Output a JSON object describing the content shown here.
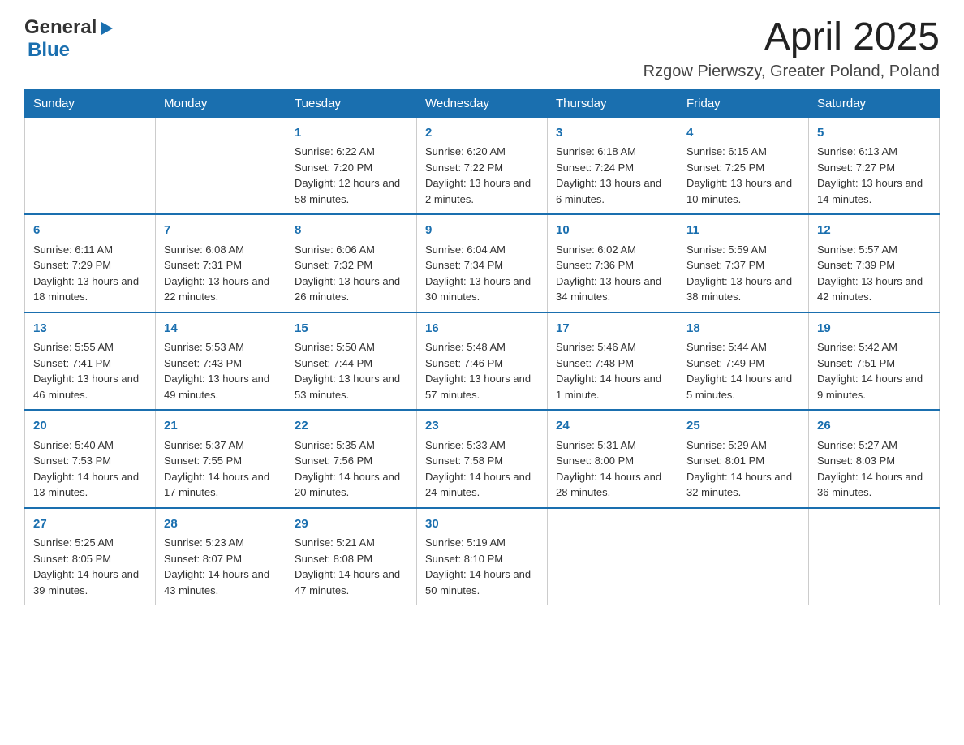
{
  "header": {
    "logo": {
      "general": "General",
      "triangle": "▶",
      "blue": "Blue"
    },
    "month_title": "April 2025",
    "location": "Rzgow Pierwszy, Greater Poland, Poland"
  },
  "weekdays": [
    "Sunday",
    "Monday",
    "Tuesday",
    "Wednesday",
    "Thursday",
    "Friday",
    "Saturday"
  ],
  "weeks": [
    [
      {
        "day": "",
        "sunrise": "",
        "sunset": "",
        "daylight": ""
      },
      {
        "day": "",
        "sunrise": "",
        "sunset": "",
        "daylight": ""
      },
      {
        "day": "1",
        "sunrise": "Sunrise: 6:22 AM",
        "sunset": "Sunset: 7:20 PM",
        "daylight": "Daylight: 12 hours and 58 minutes."
      },
      {
        "day": "2",
        "sunrise": "Sunrise: 6:20 AM",
        "sunset": "Sunset: 7:22 PM",
        "daylight": "Daylight: 13 hours and 2 minutes."
      },
      {
        "day": "3",
        "sunrise": "Sunrise: 6:18 AM",
        "sunset": "Sunset: 7:24 PM",
        "daylight": "Daylight: 13 hours and 6 minutes."
      },
      {
        "day": "4",
        "sunrise": "Sunrise: 6:15 AM",
        "sunset": "Sunset: 7:25 PM",
        "daylight": "Daylight: 13 hours and 10 minutes."
      },
      {
        "day": "5",
        "sunrise": "Sunrise: 6:13 AM",
        "sunset": "Sunset: 7:27 PM",
        "daylight": "Daylight: 13 hours and 14 minutes."
      }
    ],
    [
      {
        "day": "6",
        "sunrise": "Sunrise: 6:11 AM",
        "sunset": "Sunset: 7:29 PM",
        "daylight": "Daylight: 13 hours and 18 minutes."
      },
      {
        "day": "7",
        "sunrise": "Sunrise: 6:08 AM",
        "sunset": "Sunset: 7:31 PM",
        "daylight": "Daylight: 13 hours and 22 minutes."
      },
      {
        "day": "8",
        "sunrise": "Sunrise: 6:06 AM",
        "sunset": "Sunset: 7:32 PM",
        "daylight": "Daylight: 13 hours and 26 minutes."
      },
      {
        "day": "9",
        "sunrise": "Sunrise: 6:04 AM",
        "sunset": "Sunset: 7:34 PM",
        "daylight": "Daylight: 13 hours and 30 minutes."
      },
      {
        "day": "10",
        "sunrise": "Sunrise: 6:02 AM",
        "sunset": "Sunset: 7:36 PM",
        "daylight": "Daylight: 13 hours and 34 minutes."
      },
      {
        "day": "11",
        "sunrise": "Sunrise: 5:59 AM",
        "sunset": "Sunset: 7:37 PM",
        "daylight": "Daylight: 13 hours and 38 minutes."
      },
      {
        "day": "12",
        "sunrise": "Sunrise: 5:57 AM",
        "sunset": "Sunset: 7:39 PM",
        "daylight": "Daylight: 13 hours and 42 minutes."
      }
    ],
    [
      {
        "day": "13",
        "sunrise": "Sunrise: 5:55 AM",
        "sunset": "Sunset: 7:41 PM",
        "daylight": "Daylight: 13 hours and 46 minutes."
      },
      {
        "day": "14",
        "sunrise": "Sunrise: 5:53 AM",
        "sunset": "Sunset: 7:43 PM",
        "daylight": "Daylight: 13 hours and 49 minutes."
      },
      {
        "day": "15",
        "sunrise": "Sunrise: 5:50 AM",
        "sunset": "Sunset: 7:44 PM",
        "daylight": "Daylight: 13 hours and 53 minutes."
      },
      {
        "day": "16",
        "sunrise": "Sunrise: 5:48 AM",
        "sunset": "Sunset: 7:46 PM",
        "daylight": "Daylight: 13 hours and 57 minutes."
      },
      {
        "day": "17",
        "sunrise": "Sunrise: 5:46 AM",
        "sunset": "Sunset: 7:48 PM",
        "daylight": "Daylight: 14 hours and 1 minute."
      },
      {
        "day": "18",
        "sunrise": "Sunrise: 5:44 AM",
        "sunset": "Sunset: 7:49 PM",
        "daylight": "Daylight: 14 hours and 5 minutes."
      },
      {
        "day": "19",
        "sunrise": "Sunrise: 5:42 AM",
        "sunset": "Sunset: 7:51 PM",
        "daylight": "Daylight: 14 hours and 9 minutes."
      }
    ],
    [
      {
        "day": "20",
        "sunrise": "Sunrise: 5:40 AM",
        "sunset": "Sunset: 7:53 PM",
        "daylight": "Daylight: 14 hours and 13 minutes."
      },
      {
        "day": "21",
        "sunrise": "Sunrise: 5:37 AM",
        "sunset": "Sunset: 7:55 PM",
        "daylight": "Daylight: 14 hours and 17 minutes."
      },
      {
        "day": "22",
        "sunrise": "Sunrise: 5:35 AM",
        "sunset": "Sunset: 7:56 PM",
        "daylight": "Daylight: 14 hours and 20 minutes."
      },
      {
        "day": "23",
        "sunrise": "Sunrise: 5:33 AM",
        "sunset": "Sunset: 7:58 PM",
        "daylight": "Daylight: 14 hours and 24 minutes."
      },
      {
        "day": "24",
        "sunrise": "Sunrise: 5:31 AM",
        "sunset": "Sunset: 8:00 PM",
        "daylight": "Daylight: 14 hours and 28 minutes."
      },
      {
        "day": "25",
        "sunrise": "Sunrise: 5:29 AM",
        "sunset": "Sunset: 8:01 PM",
        "daylight": "Daylight: 14 hours and 32 minutes."
      },
      {
        "day": "26",
        "sunrise": "Sunrise: 5:27 AM",
        "sunset": "Sunset: 8:03 PM",
        "daylight": "Daylight: 14 hours and 36 minutes."
      }
    ],
    [
      {
        "day": "27",
        "sunrise": "Sunrise: 5:25 AM",
        "sunset": "Sunset: 8:05 PM",
        "daylight": "Daylight: 14 hours and 39 minutes."
      },
      {
        "day": "28",
        "sunrise": "Sunrise: 5:23 AM",
        "sunset": "Sunset: 8:07 PM",
        "daylight": "Daylight: 14 hours and 43 minutes."
      },
      {
        "day": "29",
        "sunrise": "Sunrise: 5:21 AM",
        "sunset": "Sunset: 8:08 PM",
        "daylight": "Daylight: 14 hours and 47 minutes."
      },
      {
        "day": "30",
        "sunrise": "Sunrise: 5:19 AM",
        "sunset": "Sunset: 8:10 PM",
        "daylight": "Daylight: 14 hours and 50 minutes."
      },
      {
        "day": "",
        "sunrise": "",
        "sunset": "",
        "daylight": ""
      },
      {
        "day": "",
        "sunrise": "",
        "sunset": "",
        "daylight": ""
      },
      {
        "day": "",
        "sunrise": "",
        "sunset": "",
        "daylight": ""
      }
    ]
  ]
}
